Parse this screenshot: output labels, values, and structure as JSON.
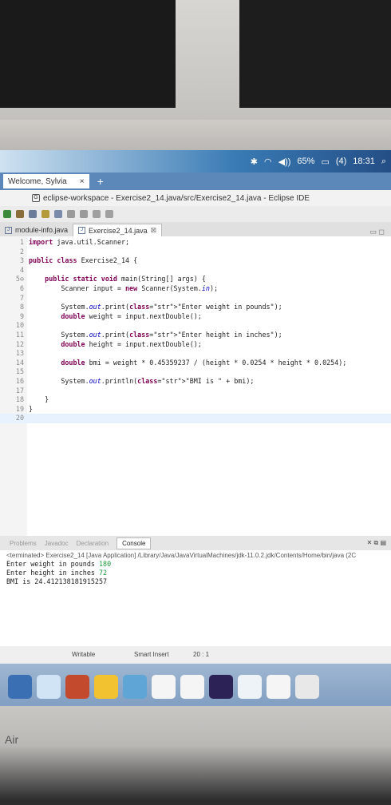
{
  "system_bar": {
    "battery": "65%",
    "badge": "(4)",
    "time": "18:31"
  },
  "browser": {
    "tab_label": "Welcome, Sylvia",
    "close_glyph": "×",
    "new_tab_glyph": "+"
  },
  "window": {
    "title": "eclipse-workspace - Exercise2_14.java/src/Exercise2_14.java - Eclipse IDE"
  },
  "editor_tabs": [
    {
      "label": "module-info.java"
    },
    {
      "label": "Exercise2_14.java"
    }
  ],
  "code_lines": [
    {
      "n": "1",
      "text": "import java.util.Scanner;"
    },
    {
      "n": "2",
      "text": ""
    },
    {
      "n": "3",
      "text": "public class Exercise2_14 {"
    },
    {
      "n": "4",
      "text": ""
    },
    {
      "n": "5⊖",
      "text": "    public static void main(String[] args) {"
    },
    {
      "n": "6",
      "text": "        Scanner input = new Scanner(System.in);"
    },
    {
      "n": "7",
      "text": ""
    },
    {
      "n": "8",
      "text": "        System.out.print(\"Enter weight in pounds\");"
    },
    {
      "n": "9",
      "text": "        double weight = input.nextDouble();"
    },
    {
      "n": "10",
      "text": ""
    },
    {
      "n": "11",
      "text": "        System.out.print(\"Enter height in inches\");"
    },
    {
      "n": "12",
      "text": "        double height = input.nextDouble();"
    },
    {
      "n": "13",
      "text": ""
    },
    {
      "n": "14",
      "text": "        double bmi = weight * 0.45359237 / (height * 0.0254 * height * 0.0254);"
    },
    {
      "n": "15",
      "text": ""
    },
    {
      "n": "16",
      "text": "        System.out.println(\"BMI is \" + bmi);"
    },
    {
      "n": "17",
      "text": ""
    },
    {
      "n": "18",
      "text": "    }"
    },
    {
      "n": "19",
      "text": "}"
    },
    {
      "n": "20",
      "text": ""
    }
  ],
  "console": {
    "tabs": [
      "Problems",
      "Javadoc",
      "Declaration",
      "Console"
    ],
    "terminated": "<terminated> Exercise2_14 [Java Application] /Library/Java/JavaVirtualMachines/jdk-11.0.2.jdk/Contents/Home/bin/java (2C",
    "lines": [
      {
        "prompt": "Enter weight in pounds ",
        "input": "180"
      },
      {
        "prompt": "Enter height in inches ",
        "input": "72"
      },
      {
        "prompt": "BMI is 24.412138181915257",
        "input": ""
      }
    ]
  },
  "status": {
    "mode": "Writable",
    "insert": "Smart Insert",
    "position": "20 : 1"
  },
  "dock": [
    {
      "icon": "launchpad-icon",
      "color": "#3b6fb3"
    },
    {
      "icon": "finder-icon",
      "color": "#d0e4f5"
    },
    {
      "icon": "powerpoint-icon",
      "color": "#c34a2c"
    },
    {
      "icon": "chrome-icon",
      "color": "#f2c230"
    },
    {
      "icon": "preview-icon",
      "color": "#5fa6d6"
    },
    {
      "icon": "g-app-icon-1",
      "color": "#f5f5f5"
    },
    {
      "icon": "g-app-icon-2",
      "color": "#f5f5f5"
    },
    {
      "icon": "eclipse-icon",
      "color": "#2c2255"
    },
    {
      "icon": "text-edit-icon",
      "color": "#eef3f8"
    },
    {
      "icon": "g-app-icon-3",
      "color": "#f5f5f5"
    },
    {
      "icon": "trash-icon",
      "color": "#e8e8e8"
    }
  ],
  "footer": {
    "brand": "Air"
  }
}
